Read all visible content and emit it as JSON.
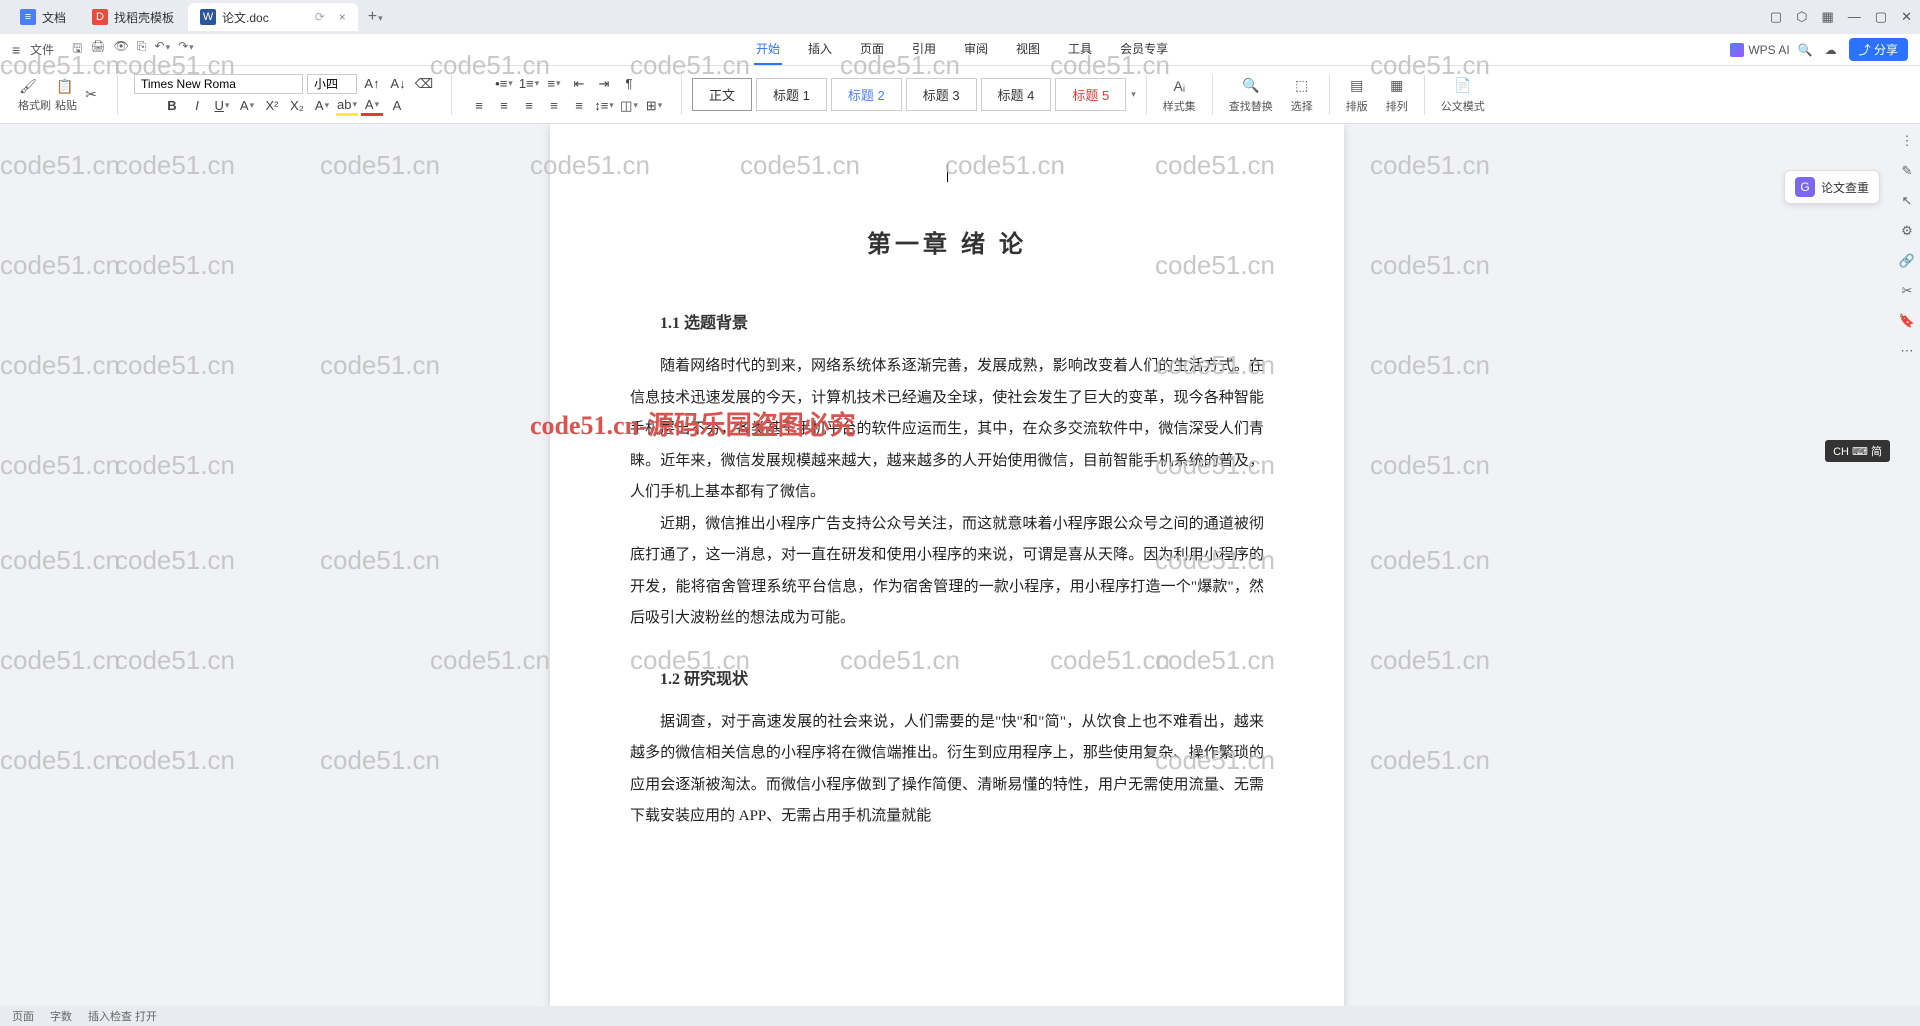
{
  "tabs": [
    {
      "label": "文档",
      "icon": "≡"
    },
    {
      "label": "找稻壳模板",
      "icon": "D"
    },
    {
      "label": "论文.doc",
      "icon": "W"
    }
  ],
  "menu": {
    "file": "文件"
  },
  "ribbon_tabs": [
    "开始",
    "插入",
    "页面",
    "引用",
    "审阅",
    "视图",
    "工具",
    "会员专享"
  ],
  "ai": {
    "label": "WPS AI"
  },
  "share": "分享",
  "clipboard": {
    "fmt": "格式刷",
    "paste": "粘贴"
  },
  "font": {
    "name": "Times New Roma",
    "size": "小四"
  },
  "styles": {
    "body": "正文",
    "h1": "标题 1",
    "h2": "标题 2",
    "h3": "标题 3",
    "h4": "标题 4",
    "h5": "标题 5",
    "set": "样式集"
  },
  "tools": {
    "find": "查找替换",
    "select": "选择",
    "layout": "排版",
    "arrange": "排列",
    "doc_mode": "公文模式"
  },
  "float": {
    "label": "论文查重"
  },
  "ime": "CH ⌨ 简",
  "doc": {
    "title": "第一章  绪  论",
    "h1_1": "1.1 选题背景",
    "p1": "随着网络时代的到来，网络系统体系逐渐完善，发展成熟，影响改变着人们的生活方式。在信息技术迅速发展的今天，计算机技术已经遍及全球，使社会发生了巨大的变革，现今各种智能手机层出不穷，各类基于手机平台的软件应运而生，其中，在众多交流软件中，微信深受人们青睐。近年来，微信发展规模越来越大，越来越多的人开始使用微信，目前智能手机系统的普及，人们手机上基本都有了微信。",
    "p2": "近期，微信推出小程序广告支持公众号关注，而这就意味着小程序跟公众号之间的通道被彻底打通了，这一消息，对一直在研发和使用小程序的来说，可谓是喜从天降。因为利用小程序的开发，能将宿舍管理系统平台信息，作为宿舍管理的一款小程序，用小程序打造一个\"爆款\"，然后吸引大波粉丝的想法成为可能。",
    "h1_2": "1.2 研究现状",
    "p3": "据调查，对于高速发展的社会来说，人们需要的是\"快\"和\"简\"，从饮食上也不难看出，越来越多的微信相关信息的小程序将在微信端推出。衍生到应用程序上，那些使用复杂、操作繁琐的应用会逐渐被淘汰。而微信小程序做到了操作简便、清晰易懂的特性，用户无需使用流量、无需下载安装应用的 APP、无需占用手机流量就能"
  },
  "watermark": "code51.cn",
  "watermark_red": "code51.cn-源码乐园盗图必究",
  "status": {
    "page": "页面",
    "words": "字数",
    "mode": "插入检查 打开"
  }
}
